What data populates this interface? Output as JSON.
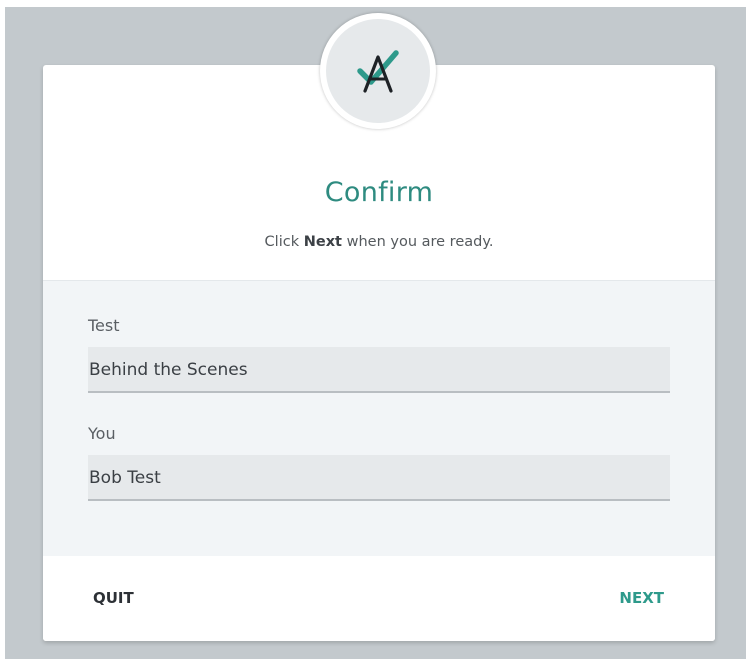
{
  "dialog": {
    "title": "Confirm",
    "subtitle_prefix": "Click ",
    "subtitle_bold": "Next",
    "subtitle_suffix": " when you are ready.",
    "logo_icon": "logo-a-check-icon",
    "accent_color": "#2e8b80"
  },
  "fields": {
    "test_label": "Test",
    "test_value": "Behind the Scenes",
    "you_label": "You",
    "you_value": "Bob Test"
  },
  "footer": {
    "quit_label": "QUIT",
    "next_label": "NEXT"
  }
}
